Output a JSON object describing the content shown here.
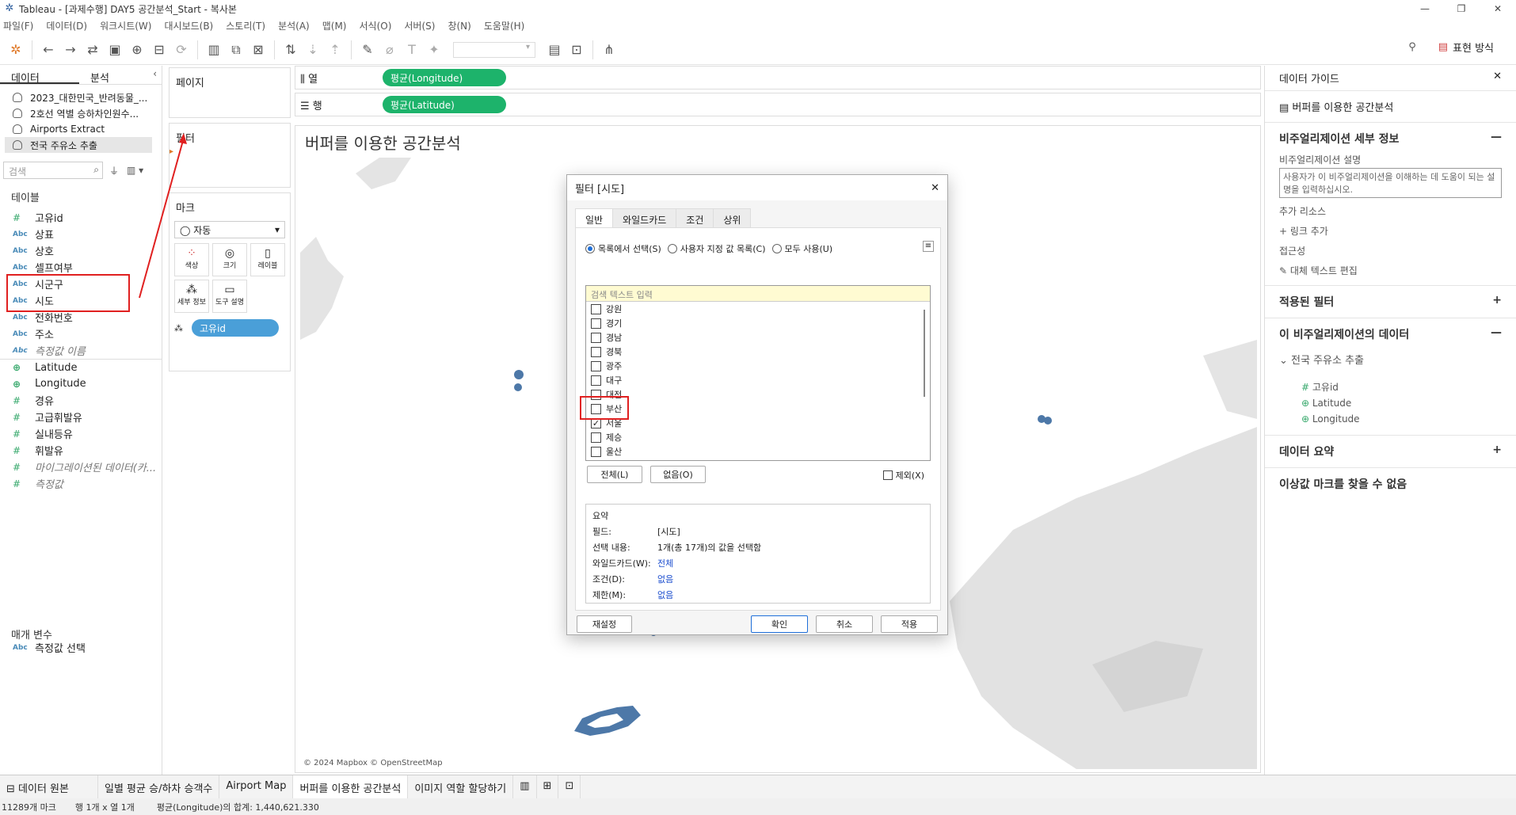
{
  "window": {
    "title": "Tableau - [과제수행] DAY5 공간분석_Start - 복사본"
  },
  "menu": [
    "파일(F)",
    "데이터(D)",
    "워크시트(W)",
    "대시보드(B)",
    "스토리(T)",
    "분석(A)",
    "맵(M)",
    "서식(O)",
    "서버(S)",
    "창(N)",
    "도움말(H)"
  ],
  "toolbar": {
    "show_me": "표현 방식"
  },
  "datapane": {
    "tab_data": "데이터",
    "tab_analysis": "분석",
    "sources": [
      "2023_대한민국_반려동물_...",
      "2호선 역별 승하차인원수...",
      "Airports Extract",
      "전국 주유소 추출"
    ],
    "search_placeholder": "검색",
    "tables_header": "테이블",
    "fields": [
      {
        "type": "#",
        "name": "고유id"
      },
      {
        "type": "Abc",
        "name": "상표"
      },
      {
        "type": "Abc",
        "name": "상호"
      },
      {
        "type": "Abc",
        "name": "셀프여부"
      },
      {
        "type": "Abc",
        "name": "시군구"
      },
      {
        "type": "Abc",
        "name": "시도"
      },
      {
        "type": "Abc",
        "name": "전화번호"
      },
      {
        "type": "Abc",
        "name": "주소"
      },
      {
        "type": "Abc",
        "name": "측정값 이름"
      },
      {
        "type": "geo",
        "name": "Latitude"
      },
      {
        "type": "geo",
        "name": "Longitude"
      },
      {
        "type": "#",
        "name": "경유"
      },
      {
        "type": "#",
        "name": "고급휘발유"
      },
      {
        "type": "#",
        "name": "실내등유"
      },
      {
        "type": "#",
        "name": "휘발유"
      },
      {
        "type": "#",
        "name": "마이그레이션된 데이터(카..."
      },
      {
        "type": "#",
        "name": "측정값"
      }
    ],
    "params_header": "매개 변수",
    "param": {
      "type": "Abc",
      "name": "측정값 선택"
    }
  },
  "shelves": {
    "pages": "페이지",
    "filters": "필터",
    "marks": "마크",
    "mark_type": "자동",
    "mark_buttons": [
      "색상",
      "크기",
      "레이블",
      "세부 정보",
      "도구 설명"
    ],
    "detail_pill": "고유id",
    "columns_label": "열",
    "rows_label": "행",
    "columns_pill": "평균(Longitude)",
    "rows_pill": "평균(Latitude)"
  },
  "viz": {
    "title": "버퍼를 이용한 공간분석",
    "attribution": "© 2024 Mapbox © OpenStreetMap"
  },
  "guide": {
    "title": "데이터 가이드",
    "sheet": "버퍼를 이용한 공간분석",
    "viz_details": "비주얼리제이션 세부 정보",
    "desc_label": "비주얼리제이션 설명",
    "desc_placeholder": "사용자가 이 비주얼리제이션을 이해하는 데 도움이 되는 설명을 입력하십시오.",
    "resources": "추가 리소스",
    "add_link": "링크 추가",
    "accessibility": "접근성",
    "alt_text": "대체 텍스트 편집",
    "applied_filters": "적용된 필터",
    "viz_data": "이 비주얼리제이션의 데이터",
    "source": "전국 주유소 추출",
    "data_fields": [
      "고유id",
      "Latitude",
      "Longitude"
    ],
    "data_summary": "데이터 요약",
    "outliers": "이상값 마크를 찾을 수 없음"
  },
  "dialog": {
    "title": "필터 [시도]",
    "tabs": [
      "일반",
      "와일드카드",
      "조건",
      "상위"
    ],
    "radio_list": "목록에서 선택(S)",
    "radio_custom": "사용자 지정 값 목록(C)",
    "radio_all": "모두 사용(U)",
    "search_placeholder": "검색 텍스트 입력",
    "items": [
      {
        "label": "강원",
        "checked": false
      },
      {
        "label": "경기",
        "checked": false
      },
      {
        "label": "경남",
        "checked": false
      },
      {
        "label": "경북",
        "checked": false
      },
      {
        "label": "광주",
        "checked": false
      },
      {
        "label": "대구",
        "checked": false
      },
      {
        "label": "대전",
        "checked": false
      },
      {
        "label": "부산",
        "checked": false
      },
      {
        "label": "서울",
        "checked": true
      },
      {
        "label": "제승",
        "checked": false
      },
      {
        "label": "울산",
        "checked": false
      }
    ],
    "btn_all": "전체(L)",
    "btn_none": "없음(O)",
    "exclude": "제외(X)",
    "summary_title": "요약",
    "summary": [
      {
        "k": "필드:",
        "v": "[시도]",
        "link": false
      },
      {
        "k": "선택 내용:",
        "v": "1개(총 17개)의 값을 선택함",
        "link": false
      },
      {
        "k": "와일드카드(W):",
        "v": "전체",
        "link": true
      },
      {
        "k": "조건(D):",
        "v": "없음",
        "link": true
      },
      {
        "k": "제한(M):",
        "v": "없음",
        "link": true
      }
    ],
    "btn_reset": "재설정",
    "btn_ok": "확인",
    "btn_cancel": "취소",
    "btn_apply": "적용"
  },
  "sheettabs": [
    "데이터 원본",
    "일별 평균 승/하차 승객수",
    "Airport Map",
    "버퍼를 이용한 공간분석",
    "이미지 역할 할당하기"
  ],
  "status": {
    "marks": "11289개 마크",
    "rows_cols": "행 1개 x 열 1개",
    "sum": "평균(Longitude)의 합계: 1,440,621.330"
  }
}
